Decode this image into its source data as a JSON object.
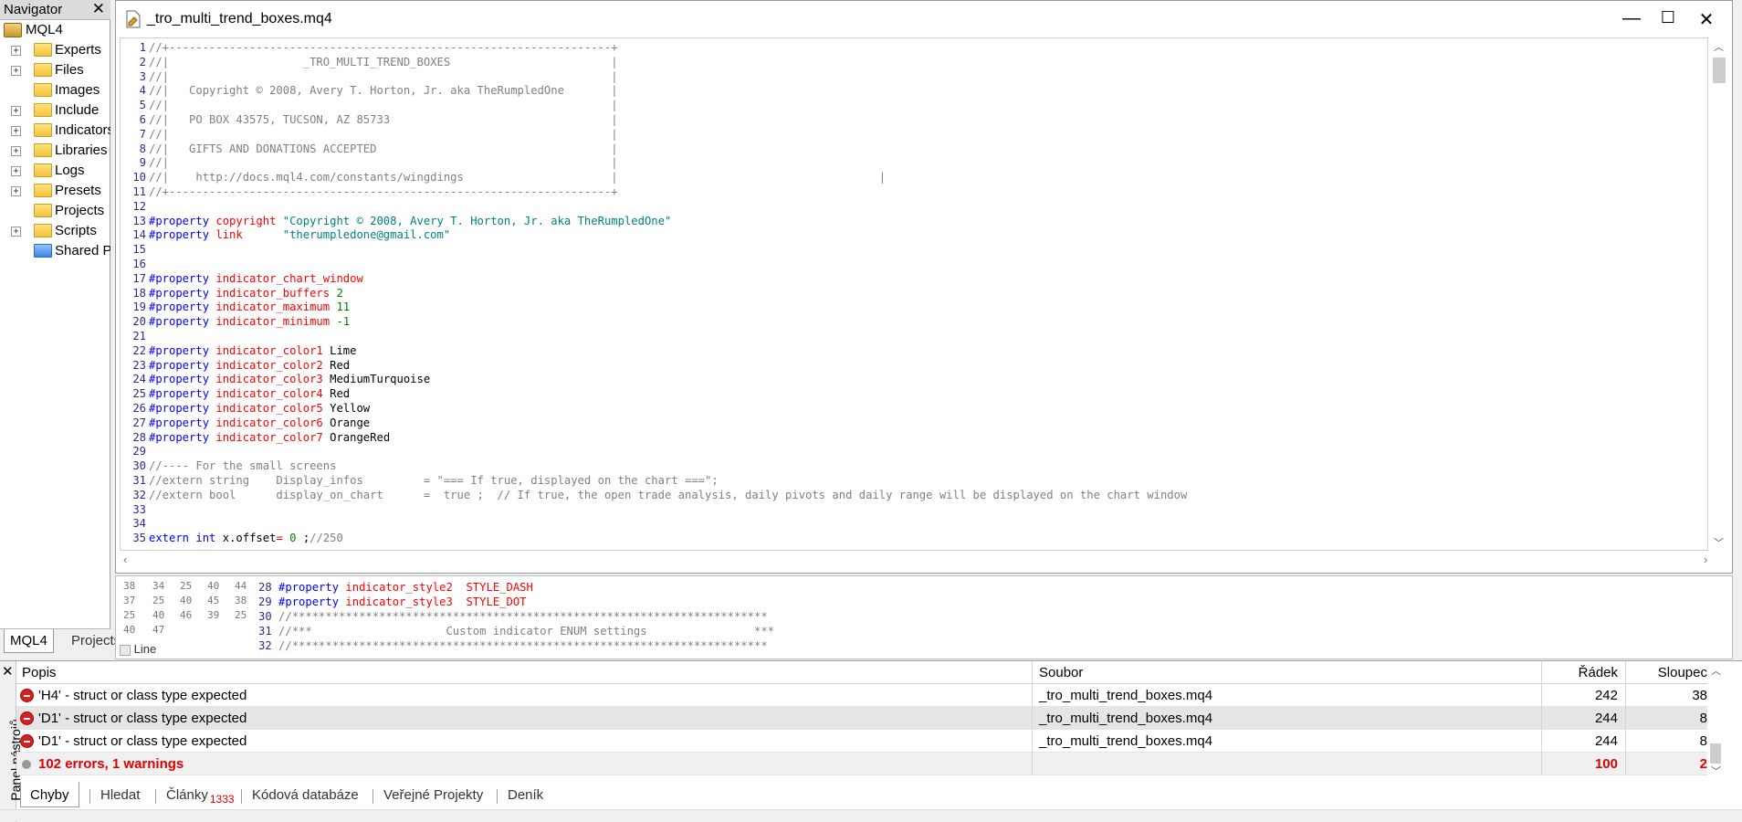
{
  "navigator": {
    "title": "Navigator",
    "close": "✕",
    "root": "MQL4",
    "items": [
      {
        "label": "Experts",
        "expand": "+",
        "color": "yellow"
      },
      {
        "label": "Files",
        "expand": "+",
        "color": "yellow"
      },
      {
        "label": "Images",
        "expand": "",
        "color": "yellow"
      },
      {
        "label": "Include",
        "expand": "+",
        "color": "yellow"
      },
      {
        "label": "Indicators",
        "expand": "+",
        "color": "yellow"
      },
      {
        "label": "Libraries",
        "expand": "+",
        "color": "yellow"
      },
      {
        "label": "Logs",
        "expand": "+",
        "color": "yellow"
      },
      {
        "label": "Presets",
        "expand": "+",
        "color": "yellow"
      },
      {
        "label": "Projects",
        "expand": "",
        "color": "yellow"
      },
      {
        "label": "Scripts",
        "expand": "+",
        "color": "yellow"
      },
      {
        "label": "Shared Projects",
        "expand": "",
        "color": "blue"
      }
    ],
    "tabs": [
      "MQL4",
      "Projects"
    ]
  },
  "editor": {
    "title": "_tro_multi_trend_boxes.mq4",
    "minimize": "—",
    "maximize": "☐",
    "close": "✕",
    "lines": [
      [
        [
          "c",
          "//+------------------------------------------------------------------+"
        ]
      ],
      [
        [
          "c",
          "//|                    _TRO_MULTI_TREND_BOXES                        |"
        ]
      ],
      [
        [
          "c",
          "//|                                                                  |"
        ]
      ],
      [
        [
          "c",
          "//|   Copyright © 2008, Avery T. Horton, Jr. aka TheRumpledOne       |"
        ]
      ],
      [
        [
          "c",
          "//|                                                                  |"
        ]
      ],
      [
        [
          "c",
          "//|   PO BOX 43575, TUCSON, AZ 85733                                 |"
        ]
      ],
      [
        [
          "c",
          "//|                                                                  |"
        ]
      ],
      [
        [
          "c",
          "//|   GIFTS AND DONATIONS ACCEPTED                                   |"
        ]
      ],
      [
        [
          "c",
          "//|                                                                  |"
        ]
      ],
      [
        [
          "c",
          "//|    http://docs.mql4.com/constants/wingdings                      |                                       |"
        ]
      ],
      [
        [
          "c",
          "//+------------------------------------------------------------------+"
        ]
      ],
      [],
      [
        [
          "p",
          "#property "
        ],
        [
          "k",
          "copyright "
        ],
        [
          "s",
          "\"Copyright © 2008, Avery T. Horton, Jr. aka TheRumpledOne\""
        ]
      ],
      [
        [
          "p",
          "#property "
        ],
        [
          "k",
          "link      "
        ],
        [
          "s",
          "\"therumpledone@gmail.com\""
        ]
      ],
      [],
      [],
      [
        [
          "p",
          "#property "
        ],
        [
          "k",
          "indicator_chart_window"
        ]
      ],
      [
        [
          "p",
          "#property "
        ],
        [
          "k",
          "indicator_buffers "
        ],
        [
          "n",
          "2"
        ]
      ],
      [
        [
          "p",
          "#property "
        ],
        [
          "k",
          "indicator_maximum "
        ],
        [
          "n",
          "11"
        ]
      ],
      [
        [
          "p",
          "#property "
        ],
        [
          "k",
          "indicator_minimum "
        ],
        [
          "n",
          "-1"
        ]
      ],
      [],
      [
        [
          "p",
          "#property "
        ],
        [
          "k",
          "indicator_color1 "
        ],
        [
          "i",
          "Lime"
        ]
      ],
      [
        [
          "p",
          "#property "
        ],
        [
          "k",
          "indicator_color2 "
        ],
        [
          "i",
          "Red"
        ]
      ],
      [
        [
          "p",
          "#property "
        ],
        [
          "k",
          "indicator_color3 "
        ],
        [
          "i",
          "MediumTurquoise"
        ]
      ],
      [
        [
          "p",
          "#property "
        ],
        [
          "k",
          "indicator_color4 "
        ],
        [
          "i",
          "Red"
        ]
      ],
      [
        [
          "p",
          "#property "
        ],
        [
          "k",
          "indicator_color5 "
        ],
        [
          "i",
          "Yellow"
        ]
      ],
      [
        [
          "p",
          "#property "
        ],
        [
          "k",
          "indicator_color6 "
        ],
        [
          "i",
          "Orange"
        ]
      ],
      [
        [
          "p",
          "#property "
        ],
        [
          "k",
          "indicator_color7 "
        ],
        [
          "i",
          "OrangeRed"
        ]
      ],
      [],
      [
        [
          "c",
          "//---- For the small screens"
        ]
      ],
      [
        [
          "c",
          "//extern string    Display_infos         = \"=== If true, displayed on the chart ===\";"
        ]
      ],
      [
        [
          "c",
          "//extern bool      display_on_chart      =  true ;  // If true, the open trade analysis, daily pivots and daily range will be displayed on the chart window"
        ]
      ],
      [],
      [],
      [
        [
          "p",
          "extern "
        ],
        [
          "p",
          "int "
        ],
        [
          "i",
          "x.offset"
        ],
        [
          "k",
          "= "
        ],
        [
          "n",
          "0 "
        ],
        [
          "i",
          ";"
        ],
        [
          "c",
          "//250"
        ]
      ]
    ]
  },
  "bg_editor": {
    "lines": [
      [
        [
          "n2",
          "28 "
        ],
        [
          "p",
          "#property "
        ],
        [
          "k",
          "indicator_style2  STYLE_DASH"
        ]
      ],
      [
        [
          "n2",
          "29 "
        ],
        [
          "p",
          "#property "
        ],
        [
          "k",
          "indicator_style3  STYLE_DOT"
        ]
      ],
      [
        [
          "n2",
          "30 "
        ],
        [
          "c",
          "//***********************************************************************"
        ]
      ],
      [
        [
          "n2",
          "31 "
        ],
        [
          "c",
          "//***                    Custom indicator ENUM settings                ***"
        ]
      ],
      [
        [
          "n2",
          "32 "
        ],
        [
          "c",
          "//***********************************************************************"
        ]
      ]
    ],
    "side_numbers": [
      "38",
      "34",
      "25",
      "40",
      "44",
      "37",
      "25",
      "40",
      "45",
      "38",
      "25",
      "40",
      "46",
      "39",
      "25",
      "40",
      "47"
    ],
    "tab_label": "Line"
  },
  "toolbox": {
    "close": "✕",
    "side_label": "Panel nástrojů",
    "headers": {
      "desc": "Popis",
      "file": "Soubor",
      "line": "Řádek",
      "col": "Sloupec"
    },
    "rows": [
      {
        "desc": "'H4' - struct or class type expected",
        "file": "_tro_multi_trend_boxes.mq4",
        "line": "242",
        "col": "38"
      },
      {
        "desc": "'D1' - struct or class type expected",
        "file": "_tro_multi_trend_boxes.mq4",
        "line": "244",
        "col": "8"
      },
      {
        "desc": "'D1' - struct or class type expected",
        "file": "_tro_multi_trend_boxes.mq4",
        "line": "244",
        "col": "8"
      }
    ],
    "summary": {
      "desc": "102 errors, 1 warnings",
      "line": "100",
      "col": "2"
    },
    "tabs": [
      {
        "label": "Chyby",
        "badge": ""
      },
      {
        "label": "Hledat",
        "badge": ""
      },
      {
        "label": "Články",
        "badge": "1333"
      },
      {
        "label": "Kódová databáze",
        "badge": ""
      },
      {
        "label": "Veřejné Projekty",
        "badge": ""
      },
      {
        "label": "Deník",
        "badge": ""
      }
    ]
  },
  "colors": {
    "comment": "#808080",
    "preprocessor": "#0000ff",
    "keyword": "#ff0000",
    "string": "#008080",
    "number": "#008000",
    "error": "#e00000"
  }
}
